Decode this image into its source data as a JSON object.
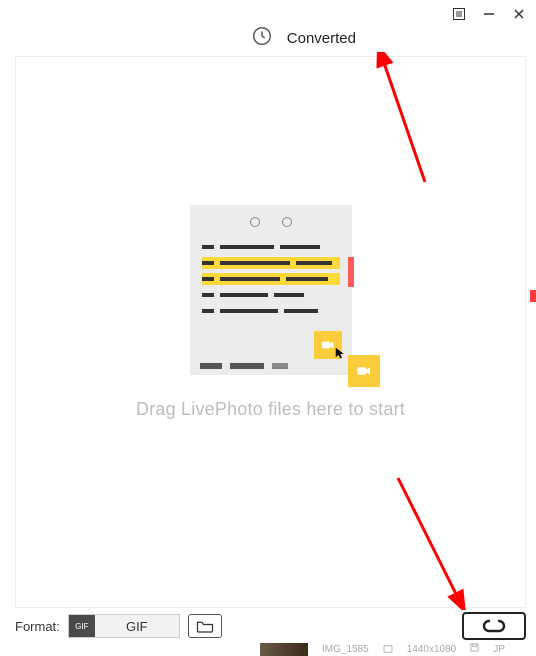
{
  "titlebar": {
    "menu_icon": "menu",
    "minimize": "−",
    "close": "×"
  },
  "header": {
    "history_icon": "clock",
    "converted_label": "Converted"
  },
  "dropzone": {
    "drop_text": "Drag LivePhoto files here to start"
  },
  "bottombar": {
    "format_label": "Format:",
    "format_badge": "GIF",
    "format_value": "GIF",
    "folder_icon": "folder",
    "convert_icon": "loop"
  },
  "background_row": {
    "filename": "IMG_1585",
    "resolution": "1440x1080",
    "ext": "JP"
  }
}
